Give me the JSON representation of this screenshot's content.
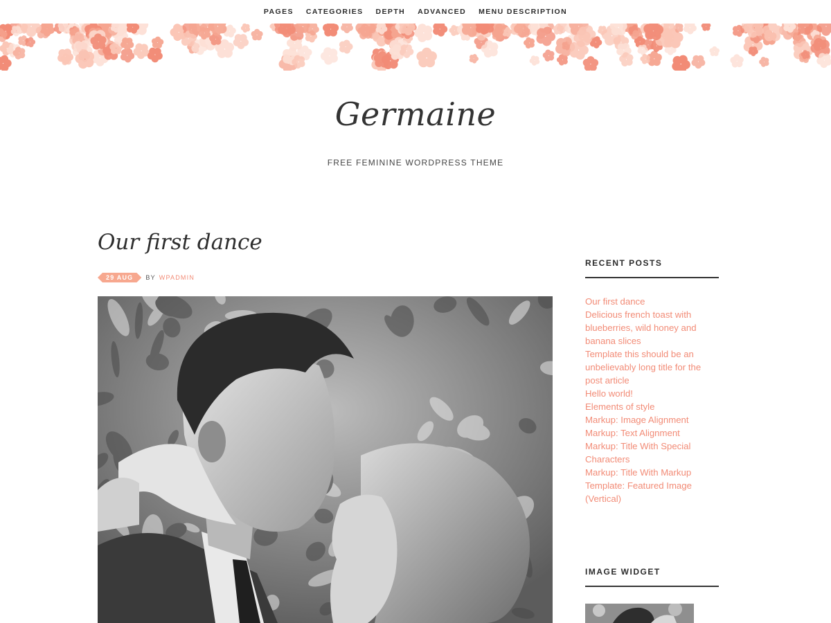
{
  "nav": {
    "items": [
      "PAGES",
      "CATEGORIES",
      "DEPTH",
      "ADVANCED",
      "MENU DESCRIPTION"
    ]
  },
  "site": {
    "title": "Germaine",
    "tagline": "FREE FEMININE WORDPRESS THEME"
  },
  "post": {
    "title": "Our first dance",
    "date": "29 AUG",
    "by": "BY",
    "author": "WPADMIN"
  },
  "sidebar": {
    "recent_posts_title": "RECENT POSTS",
    "recent_posts": [
      "Our first dance",
      "Delicious french toast with blueberries, wild honey and banana slices",
      "Template this should be an unbelievably long title for the post article",
      "Hello world!",
      "Elements of style",
      "Markup: Image Alignment",
      "Markup: Text Alignment",
      "Markup: Title With Special Characters",
      "Markup: Title With Markup",
      "Template: Featured Image (Vertical)"
    ],
    "image_widget_title": "IMAGE WIDGET"
  },
  "colors": {
    "accent": "#f28b76",
    "badge": "#f7a88f",
    "text": "#333333",
    "floral_dark": "#f28b76",
    "floral_light": "#fbc6b6"
  }
}
